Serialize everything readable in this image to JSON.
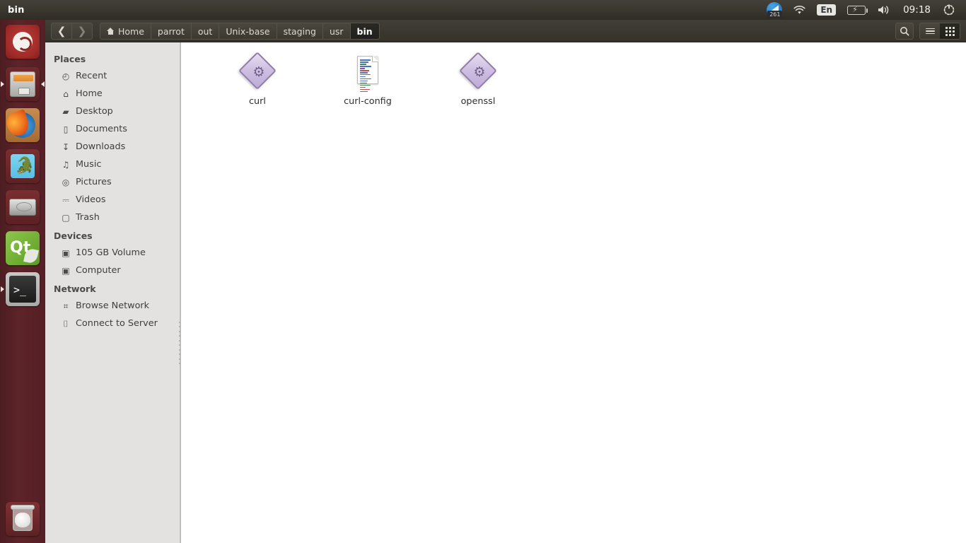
{
  "window": {
    "title": "bin"
  },
  "tray": {
    "updates_badge": "261",
    "updates_icon": "software-updates-icon",
    "wifi_icon": "wifi-icon",
    "keyboard_layout": "En",
    "battery_icon": "battery-charging-icon",
    "volume_icon": "volume-icon",
    "clock": "09:18",
    "session_icon": "system-gear-icon"
  },
  "launcher": {
    "items": [
      {
        "name": "ubuntu-dash",
        "label": "Ubuntu Dash",
        "running": false
      },
      {
        "name": "files",
        "label": "Files",
        "running": true
      },
      {
        "name": "firefox",
        "label": "Firefox",
        "running": false
      },
      {
        "name": "gecko-app",
        "label": "Gecko",
        "running": false
      },
      {
        "name": "disk-utility",
        "label": "Disks",
        "running": false
      },
      {
        "name": "qt-creator",
        "label": "Qt Creator",
        "running": false
      },
      {
        "name": "terminal",
        "label": "Terminal",
        "running": true
      }
    ],
    "trash": {
      "name": "trash",
      "label": "Trash"
    }
  },
  "toolbar": {
    "back_icon": "chevron-left-icon",
    "forward_icon": "chevron-right-icon",
    "search_icon": "search-icon",
    "list_view_icon": "list-view-icon",
    "grid_view_icon": "grid-view-icon",
    "active_view": "grid"
  },
  "breadcrumb": [
    {
      "label": "Home",
      "icon": "home-icon",
      "active": false
    },
    {
      "label": "parrot",
      "active": false
    },
    {
      "label": "out",
      "active": false
    },
    {
      "label": "Unix-base",
      "active": false
    },
    {
      "label": "staging",
      "active": false
    },
    {
      "label": "usr",
      "active": false
    },
    {
      "label": "bin",
      "active": true
    }
  ],
  "sidebar": {
    "sections": [
      {
        "title": "Places",
        "items": [
          {
            "label": "Recent",
            "icon": "clock-icon"
          },
          {
            "label": "Home",
            "icon": "home-icon"
          },
          {
            "label": "Desktop",
            "icon": "folder-icon"
          },
          {
            "label": "Documents",
            "icon": "document-icon"
          },
          {
            "label": "Downloads",
            "icon": "download-arrow-icon"
          },
          {
            "label": "Music",
            "icon": "music-note-icon"
          },
          {
            "label": "Pictures",
            "icon": "camera-icon"
          },
          {
            "label": "Videos",
            "icon": "film-icon"
          },
          {
            "label": "Trash",
            "icon": "trash-icon"
          }
        ]
      },
      {
        "title": "Devices",
        "items": [
          {
            "label": "105 GB Volume",
            "icon": "drive-icon"
          },
          {
            "label": "Computer",
            "icon": "drive-icon"
          }
        ]
      },
      {
        "title": "Network",
        "items": [
          {
            "label": "Browse Network",
            "icon": "network-icon"
          },
          {
            "label": "Connect to Server",
            "icon": "server-icon"
          }
        ]
      }
    ]
  },
  "files": [
    {
      "name": "curl",
      "type": "executable"
    },
    {
      "name": "curl-config",
      "type": "script"
    },
    {
      "name": "openssl",
      "type": "executable"
    }
  ],
  "colors": {
    "panel": "#3a372f",
    "launcher": "#5d2429",
    "sidebar": "#e4e2e0",
    "content": "#ffffff",
    "exe_purple": "#bdabd6",
    "accent_orange": "#df8a2e"
  }
}
